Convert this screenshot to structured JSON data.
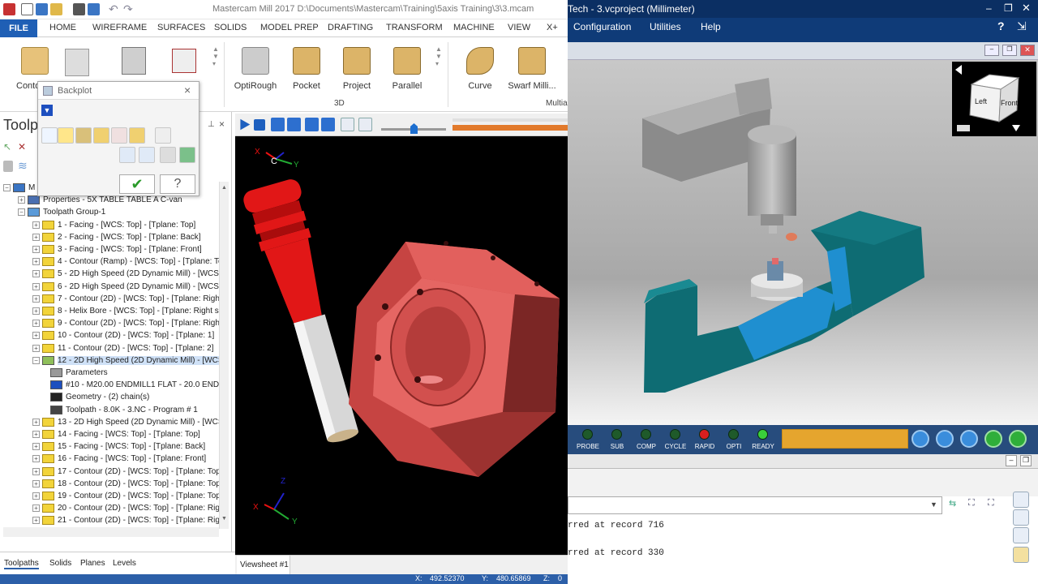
{
  "mastercam": {
    "title": "Mastercam Mill 2017  D:\\Documents\\Mastercam\\Training\\5axis Training\\3\\3.mcam",
    "file_tab": "FILE",
    "ribbon_tabs": [
      "HOME",
      "WIREFRAME",
      "SURFACES",
      "SOLIDS",
      "MODEL PREP",
      "DRAFTING",
      "TRANSFORM",
      "MACHINE",
      "VIEW",
      "X+"
    ],
    "ribbon_buttons": [
      "Conto",
      "OptiRough",
      "Pocket",
      "Project",
      "Parallel",
      "Curve",
      "Swarf Milli..."
    ],
    "ribbon_group_3d": "3D",
    "ribbon_group_multi": "Multia",
    "panel_title": "Toolpa",
    "backplot_title": "Backplot",
    "tree": {
      "root": "M",
      "properties": "Properties - 5X TABLE TABLE A C-van",
      "group": "Toolpath Group-1",
      "ops": [
        "1 - Facing - [WCS: Top] - [Tplane: Top]",
        "2 - Facing - [WCS: Top] - [Tplane: Back]",
        "3 - Facing - [WCS: Top] - [Tplane: Front]",
        "4 - Contour (Ramp) - [WCS: Top] - [Tplane: To",
        "5 - 2D High Speed (2D Dynamic Mill) - [WCS: To",
        "6 - 2D High Speed (2D Dynamic Mill) - [WCS: To",
        "7 - Contour (2D) - [WCS: Top] - [Tplane: Right",
        "8 - Helix Bore - [WCS: Top] - [Tplane: Right sid",
        "9 - Contour (2D) - [WCS: Top] - [Tplane: Right",
        "10 - Contour (2D) - [WCS: Top] - [Tplane: 1]",
        "11 - Contour (2D) - [WCS: Top] - [Tplane: 2]",
        "12 - 2D High Speed (2D Dynamic Mill) - [WCS: T"
      ],
      "sub": [
        "Parameters",
        "#10 - M20.00 ENDMILL1 FLAT - 20.0 ENDM",
        "Geometry - (2) chain(s)",
        "Toolpath - 8.0K - 3.NC - Program # 1"
      ],
      "ops2": [
        "13 - 2D High Speed (2D Dynamic Mill) - [WCS: T",
        "14 - Facing - [WCS: Top] - [Tplane: Top]",
        "15 - Facing - [WCS: Top] - [Tplane: Back]",
        "16 - Facing - [WCS: Top] - [Tplane: Front]",
        "17 - Contour (2D) - [WCS: Top] - [Tplane: Top]",
        "18 - Contour (2D) - [WCS: Top] - [Tplane: Top]",
        "19 - Contour (2D) - [WCS: Top] - [Tplane: Top]",
        "20 - Contour (2D) - [WCS: Top] - [Tplane: Righ",
        "21 - Contour (2D) - [WCS: Top] - [Tplane: Righ"
      ]
    },
    "bottom_tabs": [
      "Toolpaths",
      "Solids",
      "Planes",
      "Levels"
    ],
    "viewsheet_tab": "Viewsheet #1",
    "axis_labels": {
      "x": "X",
      "y": "Y",
      "z": "Z",
      "c": "C"
    },
    "status": {
      "x_label": "X:",
      "x_val": "492.52370",
      "y_label": "Y:",
      "y_val": "480.65869",
      "z_label": "Z:",
      "z_val": "0"
    }
  },
  "vericut": {
    "title": "Tech - 3.vcproject (Millimeter)",
    "menu": [
      "Configuration",
      "Utilities",
      "Help"
    ],
    "cube_faces": {
      "left": "Left",
      "front": "Front"
    },
    "leds": [
      "PROBE",
      "SUB",
      "COMP",
      "CYCLE",
      "RAPID",
      "OPTI",
      "READY"
    ],
    "log_lines": [
      "rred at record 716",
      "rred at record 330"
    ]
  },
  "colors": {
    "mc_blue": "#1f5fb5",
    "vc_navy": "#0f3b78",
    "part_red": "#d9504e",
    "tool_red": "#e11717",
    "fixture_teal": "#0e6c73",
    "fixture_blue": "#1f8fd0"
  }
}
